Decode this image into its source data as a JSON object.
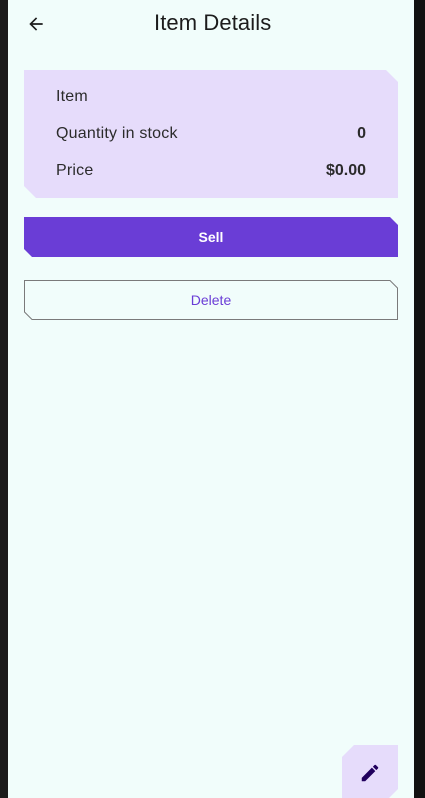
{
  "app_bar": {
    "title": "Item Details",
    "back_icon": "arrow-back-icon"
  },
  "details": {
    "item_label": "Item",
    "item_value": "",
    "quantity_label": "Quantity in stock",
    "quantity_value": "0",
    "price_label": "Price",
    "price_value": "$0.00"
  },
  "actions": {
    "sell_label": "Sell",
    "delete_label": "Delete"
  },
  "fab": {
    "icon": "edit-pencil-icon"
  },
  "colors": {
    "background": "#f1fdfb",
    "card": "#e6dcfb",
    "primary": "#6a3dd6"
  }
}
